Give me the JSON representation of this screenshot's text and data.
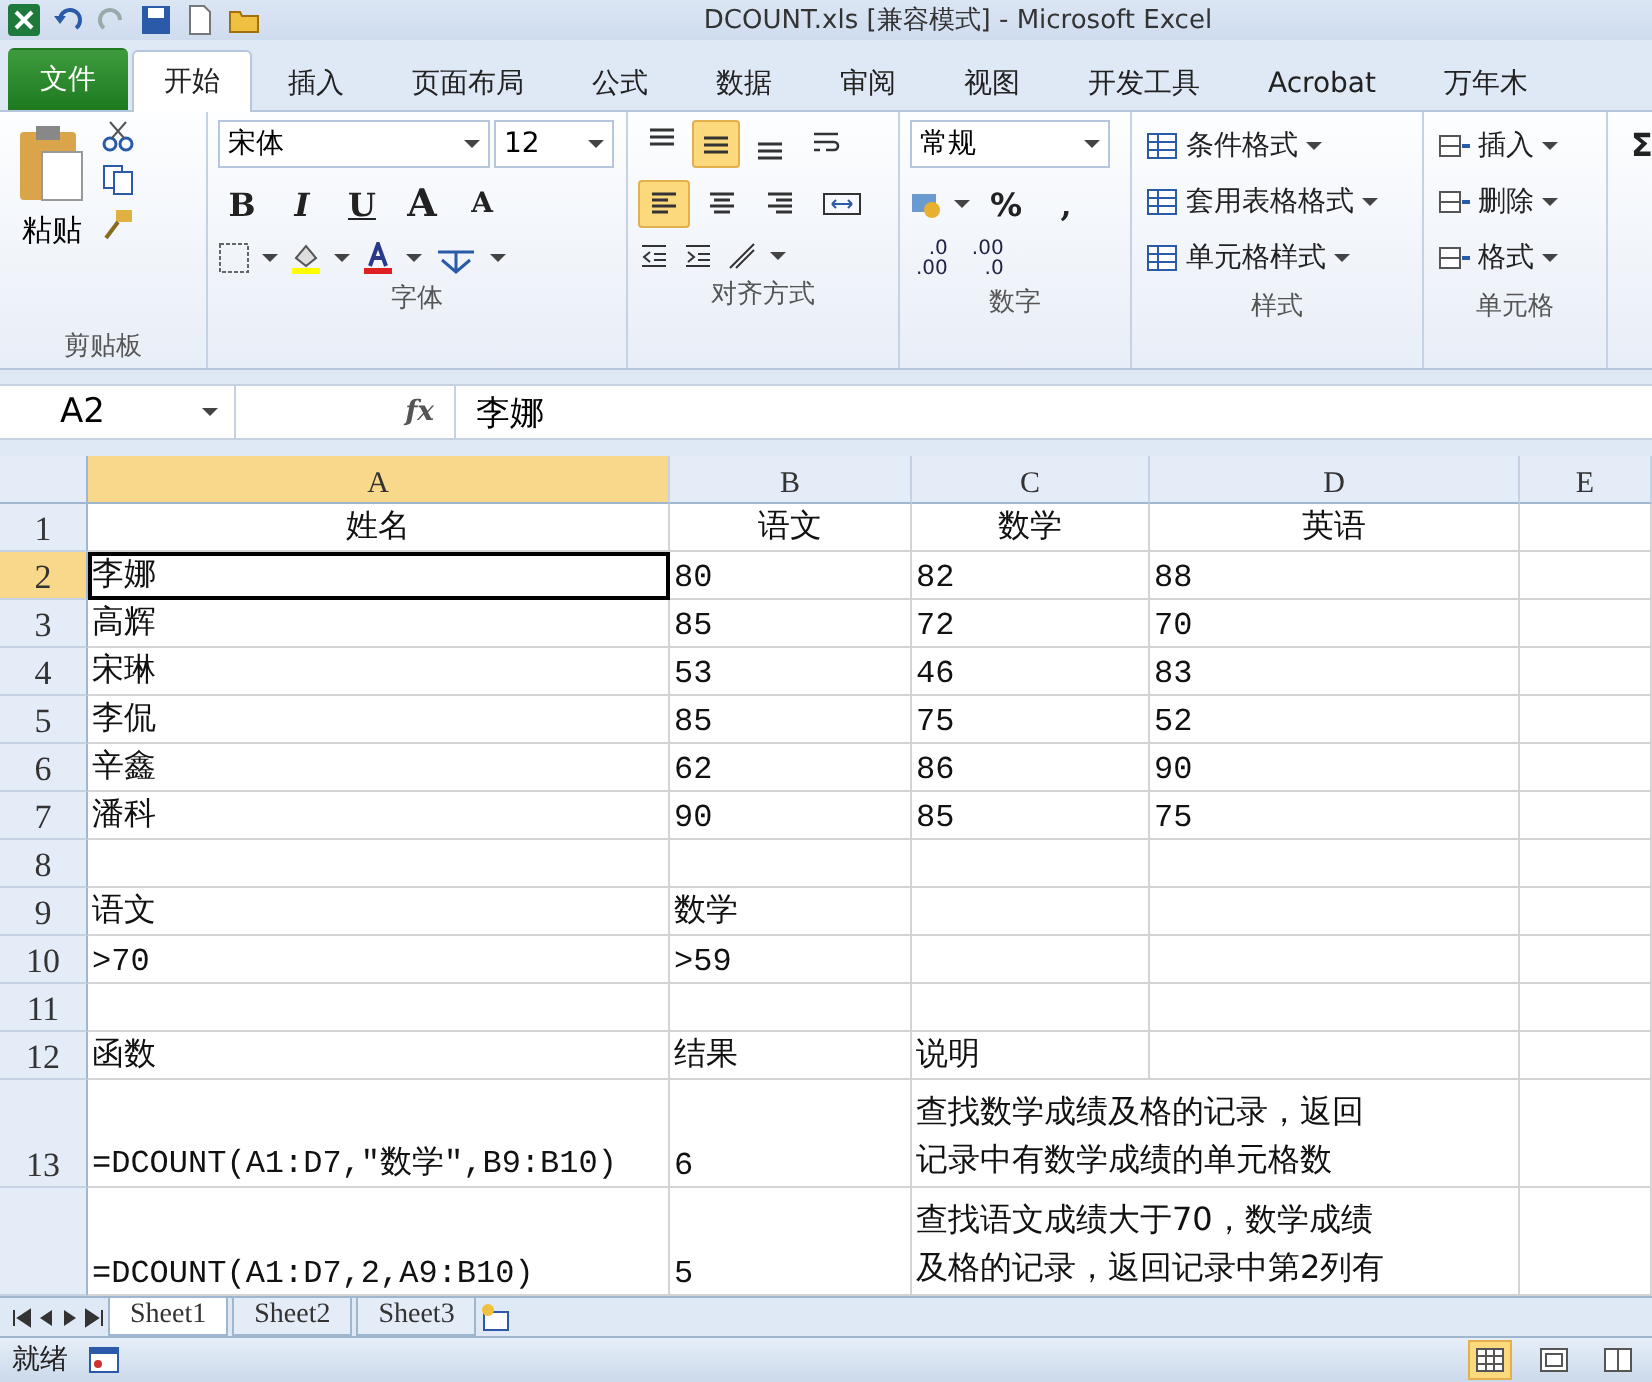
{
  "window": {
    "title": "DCOUNT.xls  [兼容模式]  -  Microsoft Excel"
  },
  "ribbon_tabs": [
    {
      "label": "文件",
      "kind": "file"
    },
    {
      "label": "开始",
      "kind": "tab",
      "selected": true
    },
    {
      "label": "插入",
      "kind": "tab",
      "selected": false
    },
    {
      "label": "页面布局",
      "kind": "tab",
      "selected": false
    },
    {
      "label": "公式",
      "kind": "tab",
      "selected": false
    },
    {
      "label": "数据",
      "kind": "tab",
      "selected": false
    },
    {
      "label": "审阅",
      "kind": "tab",
      "selected": false
    },
    {
      "label": "视图",
      "kind": "tab",
      "selected": false
    },
    {
      "label": "开发工具",
      "kind": "tab",
      "selected": false
    },
    {
      "label": "Acrobat",
      "kind": "tab",
      "selected": false
    },
    {
      "label": "万年木",
      "kind": "tab",
      "selected": false
    }
  ],
  "clipboard": {
    "label": "剪贴板",
    "paste": "粘贴"
  },
  "font": {
    "label": "字体",
    "font_name": "宋体",
    "font_size": "12",
    "bold": "B",
    "italic": "I",
    "underline": "U",
    "grow": "A",
    "shrink": "A"
  },
  "alignment": {
    "label": "对齐方式",
    "buttons": [
      {
        "kind": "top",
        "selected": false
      },
      {
        "kind": "middle",
        "selected": true
      },
      {
        "kind": "bottom",
        "selected": false
      },
      {
        "kind": "wrap",
        "selected": false
      },
      {
        "kind": "left",
        "selected": true
      },
      {
        "kind": "center",
        "selected": false
      },
      {
        "kind": "right",
        "selected": false
      },
      {
        "kind": "merge",
        "selected": false
      }
    ]
  },
  "number": {
    "label": "数字",
    "format": "常规",
    "percent": "%",
    "comma": ",",
    "decimals": [
      {
        "top": ".0",
        "bottom": ".00"
      },
      {
        "top": ".00",
        "bottom": ".0"
      }
    ]
  },
  "styles": {
    "label": "样式",
    "commands": [
      "条件格式",
      "套用表格格式",
      "单元格样式"
    ]
  },
  "cells_group": {
    "label": "单元格",
    "commands": [
      "插入",
      "删除",
      "格式"
    ]
  },
  "editing": {
    "sigma": "Σ"
  },
  "formula_bar": {
    "name_box": "A2",
    "fx": "fx",
    "value": "李娜"
  },
  "sheet": {
    "columns": [
      {
        "label": "A",
        "selected": true
      },
      {
        "label": "B",
        "selected": false
      },
      {
        "label": "C",
        "selected": false
      },
      {
        "label": "D",
        "selected": false
      },
      {
        "label": "E",
        "selected": false
      }
    ],
    "rows": [
      {
        "label": "1",
        "selected": false,
        "kind": "header",
        "cells": [
          {
            "text": "姓名"
          },
          {
            "text": "语文"
          },
          {
            "text": "数学"
          },
          {
            "text": "英语"
          },
          {
            "text": ""
          }
        ]
      },
      {
        "label": "2",
        "selected": true,
        "cells": [
          {
            "text": "李娜"
          },
          {
            "text": "80"
          },
          {
            "text": "82"
          },
          {
            "text": "88"
          },
          {
            "text": ""
          }
        ]
      },
      {
        "label": "3",
        "selected": false,
        "cells": [
          {
            "text": "高辉"
          },
          {
            "text": "85"
          },
          {
            "text": "72"
          },
          {
            "text": "70"
          },
          {
            "text": ""
          }
        ]
      },
      {
        "label": "4",
        "selected": false,
        "cells": [
          {
            "text": "宋琳"
          },
          {
            "text": "53"
          },
          {
            "text": "46"
          },
          {
            "text": "83"
          },
          {
            "text": ""
          }
        ]
      },
      {
        "label": "5",
        "selected": false,
        "cells": [
          {
            "text": "李侃"
          },
          {
            "text": "85"
          },
          {
            "text": "75"
          },
          {
            "text": "52"
          },
          {
            "text": ""
          }
        ]
      },
      {
        "label": "6",
        "selected": false,
        "cells": [
          {
            "text": "辛鑫"
          },
          {
            "text": "62"
          },
          {
            "text": "86"
          },
          {
            "text": "90"
          },
          {
            "text": ""
          }
        ]
      },
      {
        "label": "7",
        "selected": false,
        "cells": [
          {
            "text": "潘科"
          },
          {
            "text": "90"
          },
          {
            "text": "85"
          },
          {
            "text": "75"
          },
          {
            "text": ""
          }
        ]
      },
      {
        "label": "8",
        "selected": false,
        "cells": [
          {
            "text": ""
          },
          {
            "text": ""
          },
          {
            "text": ""
          },
          {
            "text": ""
          },
          {
            "text": ""
          }
        ]
      },
      {
        "label": "9",
        "selected": false,
        "cells": [
          {
            "text": "语文"
          },
          {
            "text": "数学"
          },
          {
            "text": ""
          },
          {
            "text": ""
          },
          {
            "text": ""
          }
        ]
      },
      {
        "label": "10",
        "selected": false,
        "cells": [
          {
            "text": ">70"
          },
          {
            "text": ">59"
          },
          {
            "text": ""
          },
          {
            "text": ""
          },
          {
            "text": ""
          }
        ]
      },
      {
        "label": "11",
        "selected": false,
        "cells": [
          {
            "text": ""
          },
          {
            "text": ""
          },
          {
            "text": ""
          },
          {
            "text": ""
          },
          {
            "text": ""
          }
        ]
      },
      {
        "label": "12",
        "selected": false,
        "cells": [
          {
            "text": "函数"
          },
          {
            "text": "结果"
          },
          {
            "text": "说明"
          },
          {
            "text": ""
          },
          {
            "text": ""
          }
        ]
      },
      {
        "label": "13",
        "selected": false,
        "cells": [
          {
            "text": "=DCOUNT(A1:D7,\"数学\",B9:B10)"
          },
          {
            "text": "6"
          },
          {
            "lines": [
              "查找数学成绩及格的记录，返回",
              "记录中有数学成绩的单元格数"
            ],
            "merged": true
          },
          {
            "text": ""
          }
        ]
      },
      {
        "label": "",
        "selected": false,
        "cells": [
          {
            "text": "=DCOUNT(A1:D7,2,A9:B10)"
          },
          {
            "text": "5"
          },
          {
            "lines": [
              "查找语文成绩大于70，数学成绩",
              "及格的记录，返回记录中第2列有"
            ],
            "merged": true
          },
          {
            "text": ""
          }
        ]
      }
    ]
  },
  "sheet_tabs": [
    {
      "label": "Sheet1",
      "selected": true
    },
    {
      "label": "Sheet2",
      "selected": false
    },
    {
      "label": "Sheet3",
      "selected": false
    }
  ],
  "status_bar": {
    "text": "就绪",
    "views": [
      {
        "kind": "normal",
        "selected": true
      },
      {
        "kind": "layout",
        "selected": false
      },
      {
        "kind": "break",
        "selected": false
      }
    ]
  }
}
